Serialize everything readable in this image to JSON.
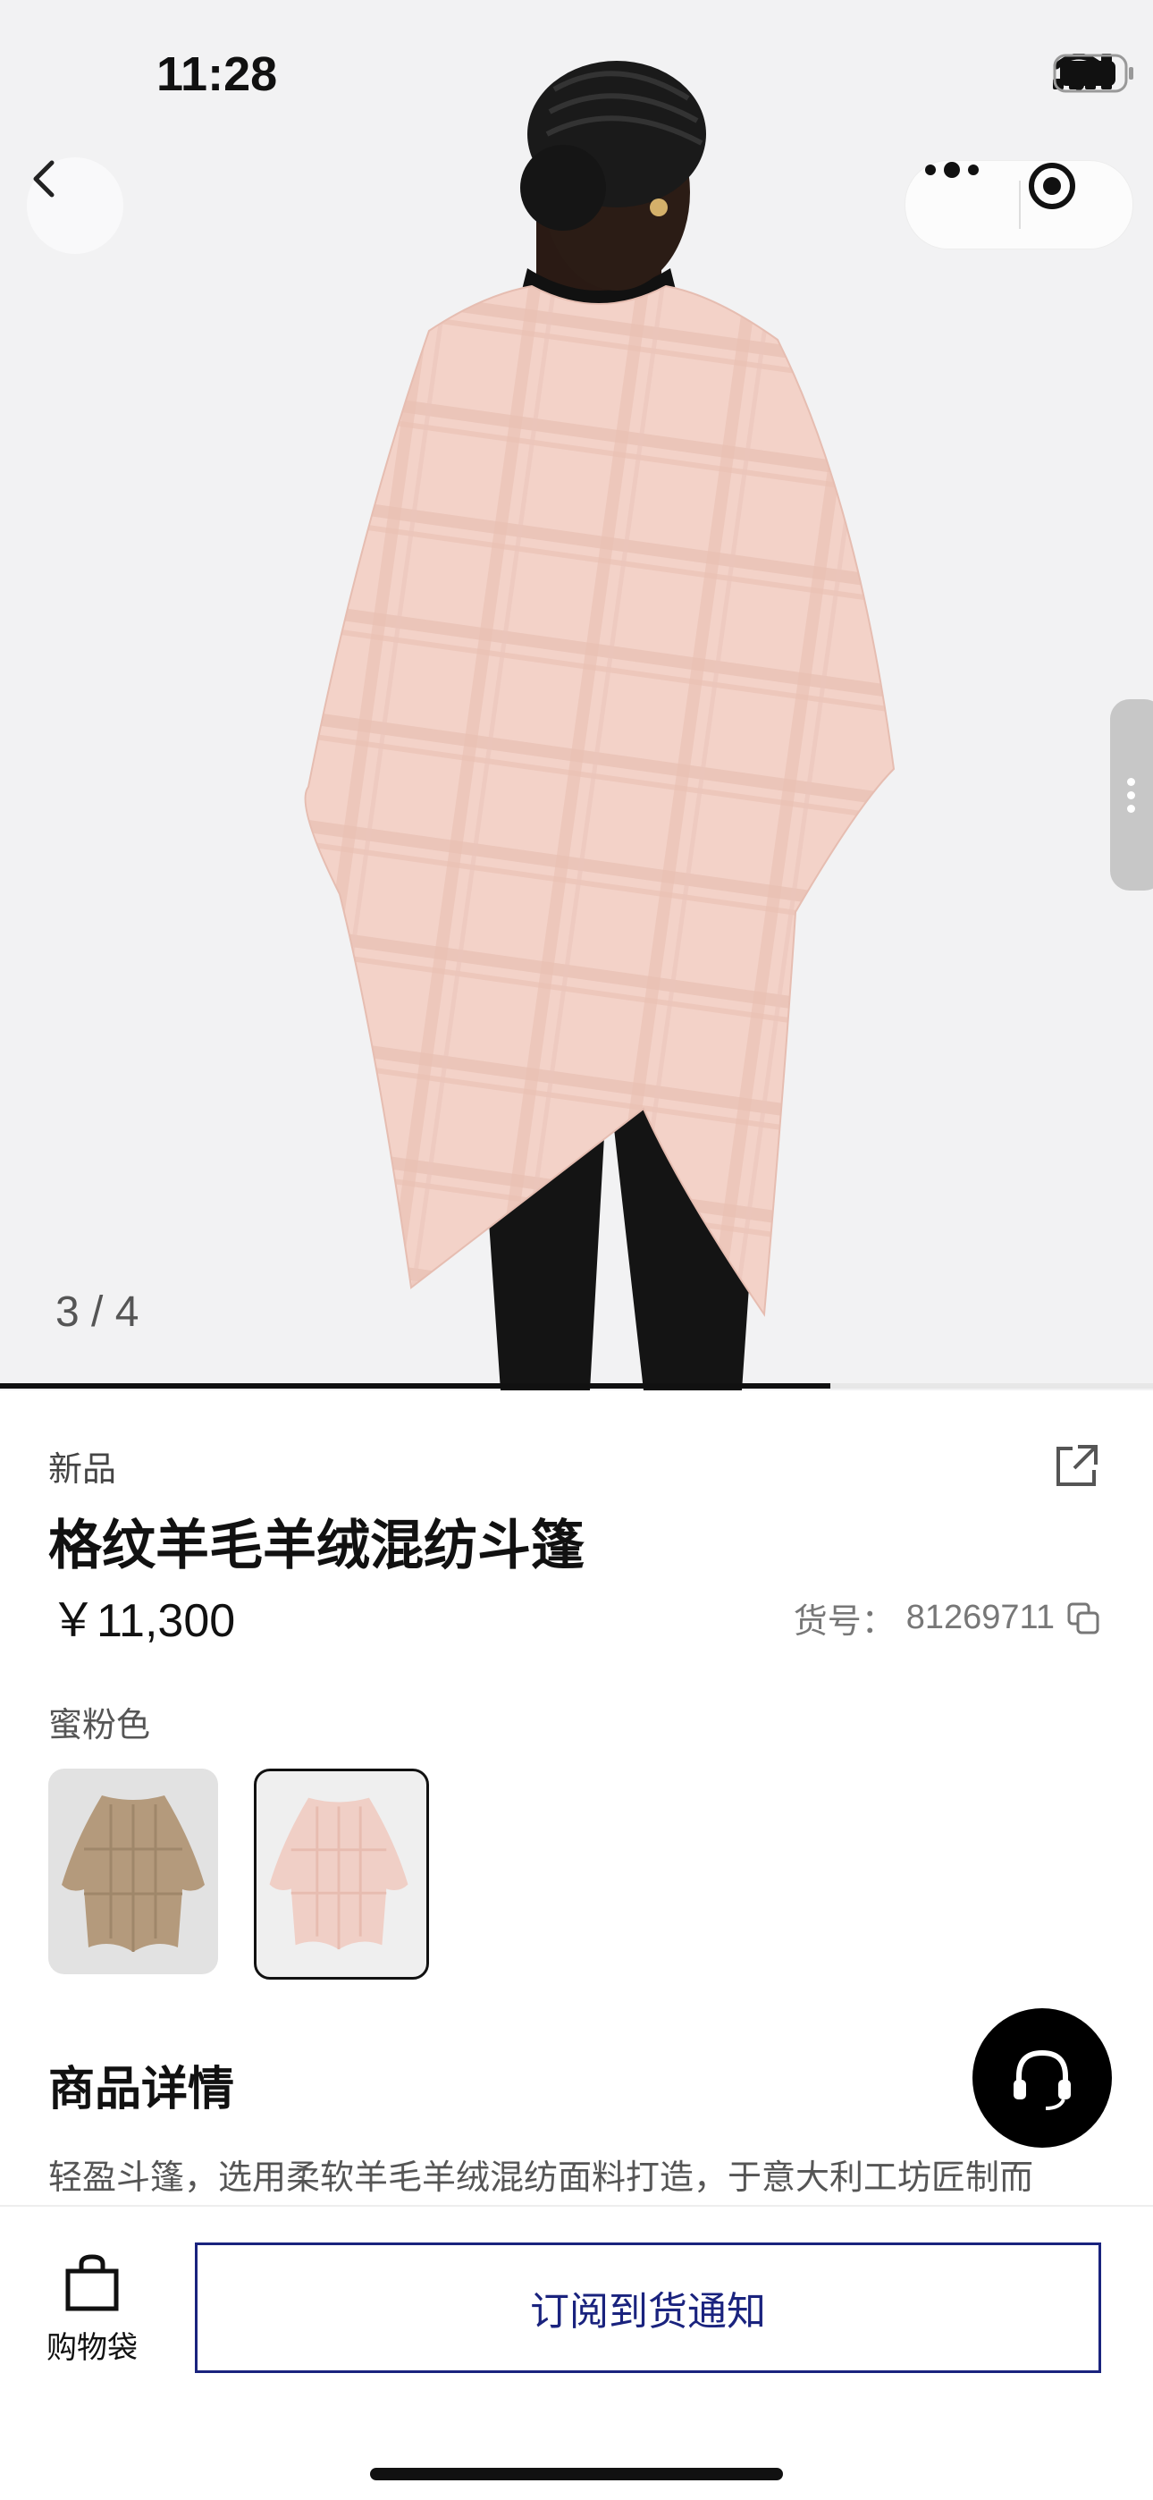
{
  "status_bar": {
    "time": "11:28"
  },
  "gallery": {
    "counter": "3 / 4",
    "current": 3,
    "total": 4,
    "progress_fraction": 0.75
  },
  "product": {
    "tag": "新品",
    "title": "格纹羊毛羊绒混纺斗篷",
    "price": "￥11,300",
    "sku_label": "货号：",
    "sku_number": "81269711",
    "color_name": "蜜粉色",
    "swatches": [
      {
        "name": "beige",
        "selected": false
      },
      {
        "name": "blush pink",
        "selected": true
      }
    ]
  },
  "details": {
    "title": "商品详情",
    "text": "轻盈斗篷，选用柔软羊毛羊绒混纺面料打造，于意大利工坊匠制而"
  },
  "bottom_bar": {
    "bag_label": "购物袋",
    "notify_label": "订阅到货通知"
  },
  "colors": {
    "accent": "#1a237e",
    "cape_pink": "#f2cfc4",
    "background": "#f2f2f3"
  }
}
